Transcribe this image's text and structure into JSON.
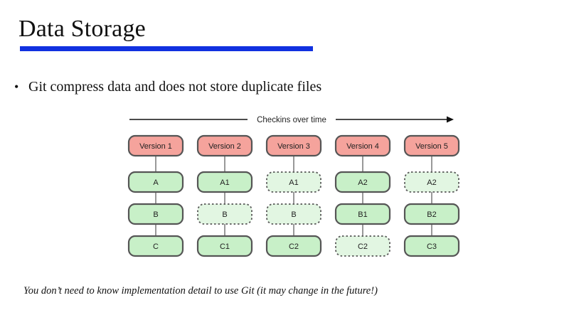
{
  "slide": {
    "title": "Data Storage",
    "bullet": "Git compress data and does not store duplicate files",
    "caption": "You don’t need to know implementation detail to use Git (it may change in the future!)"
  },
  "diagram": {
    "arrow_label": "Checkins over time",
    "colors": {
      "version_fill": "#f5a39c",
      "file_fill": "#c8f0c8",
      "unchanged_fill": "#e2f6e2",
      "border": "#555555"
    },
    "versions": [
      {
        "label": "Version 1",
        "files": [
          {
            "label": "A",
            "changed": true
          },
          {
            "label": "B",
            "changed": true
          },
          {
            "label": "C",
            "changed": true
          }
        ]
      },
      {
        "label": "Version 2",
        "files": [
          {
            "label": "A1",
            "changed": true
          },
          {
            "label": "B",
            "changed": false
          },
          {
            "label": "C1",
            "changed": true
          }
        ]
      },
      {
        "label": "Version 3",
        "files": [
          {
            "label": "A1",
            "changed": false
          },
          {
            "label": "B",
            "changed": false
          },
          {
            "label": "C2",
            "changed": true
          }
        ]
      },
      {
        "label": "Version 4",
        "files": [
          {
            "label": "A2",
            "changed": true
          },
          {
            "label": "B1",
            "changed": true
          },
          {
            "label": "C2",
            "changed": false
          }
        ]
      },
      {
        "label": "Version 5",
        "files": [
          {
            "label": "A2",
            "changed": false
          },
          {
            "label": "B2",
            "changed": true
          },
          {
            "label": "C3",
            "changed": true
          }
        ]
      }
    ]
  }
}
